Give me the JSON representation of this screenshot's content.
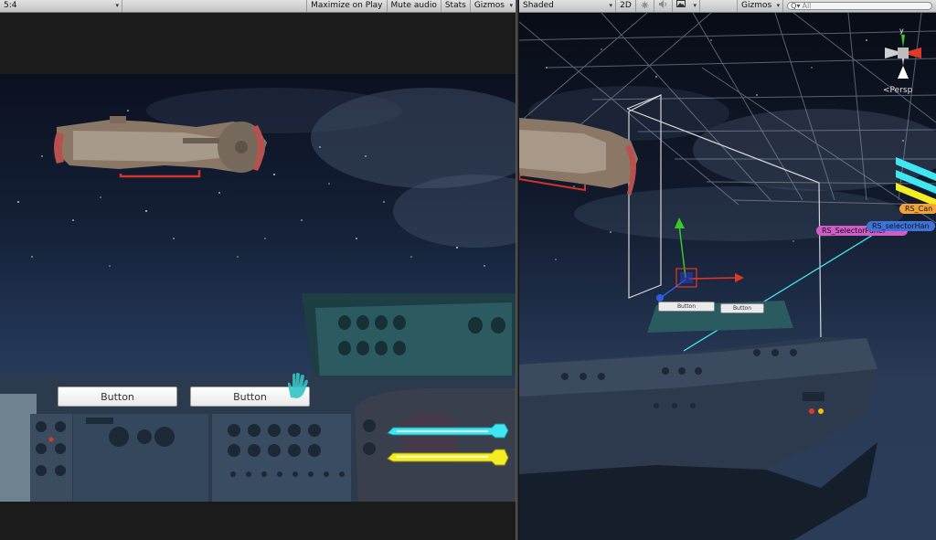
{
  "game_toolbar": {
    "aspect": "5:4",
    "maximize_on_play": "Maximize on Play",
    "mute_audio": "Mute audio",
    "stats": "Stats",
    "gizmos": "Gizmos"
  },
  "scene_toolbar": {
    "shading": "Shaded",
    "mode_2d": "2D",
    "gizmos": "Gizmos",
    "search_placeholder": "All",
    "search_prefix": "Q▾"
  },
  "game_view": {
    "buttons": [
      "Button",
      "Button"
    ]
  },
  "scene_view": {
    "persp_label": "Persp",
    "gizmo_axis_y": "y",
    "tags": [
      "RS_Can",
      "RS_SelectorPanel",
      "RS_selectorHan"
    ],
    "mini_buttons": [
      "Button",
      "Button"
    ]
  },
  "colors": {
    "toolbar_bg": "#d0d0d0",
    "cyan_bar": "#3fe7f2",
    "yellow_bar": "#f2ee22",
    "tag_orange": "#f0a43a",
    "tag_magenta": "#d15bc8",
    "tag_blue": "#3f72d6"
  },
  "icons": [
    "sun-icon",
    "speaker-icon",
    "image-icon",
    "search-icon",
    "hand-cursor-icon",
    "scene-orientation-gizmo-icon"
  ]
}
